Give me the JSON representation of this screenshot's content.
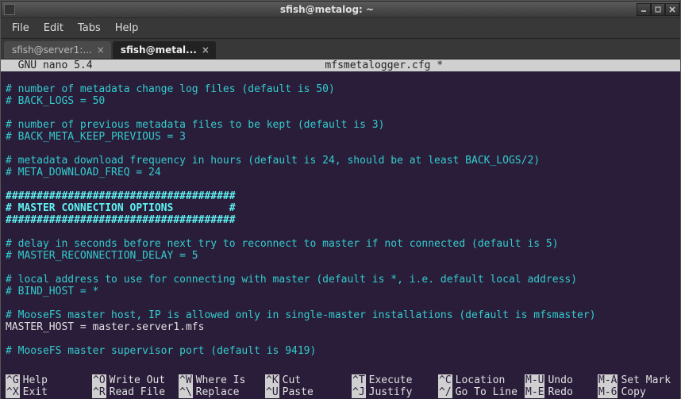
{
  "window": {
    "title": "sfish@metalog: ~"
  },
  "menu": {
    "file": "File",
    "edit": "Edit",
    "tabs": "Tabs",
    "help": "Help"
  },
  "tabs": [
    {
      "label": "sfish@server1:...",
      "active": false
    },
    {
      "label": "sfish@metal...",
      "active": true
    }
  ],
  "nano": {
    "version": "  GNU nano 5.4",
    "filename": "mfsmetalogger.cfg *"
  },
  "content": {
    "l1": "# number of metadata change log files (default is 50)",
    "l2": "# BACK_LOGS = 50",
    "l3": "# number of previous metadata files to be kept (default is 3)",
    "l4": "# BACK_META_KEEP_PREVIOUS = 3",
    "l5": "# metadata download frequency in hours (default is 24, should be at least BACK_LOGS/2)",
    "l6": "# META_DOWNLOAD_FREQ = 24",
    "l7": "#####################################",
    "l8": "# MASTER CONNECTION OPTIONS         #",
    "l9": "#####################################",
    "l10": "# delay in seconds before next try to reconnect to master if not connected (default is 5)",
    "l11": "# MASTER_RECONNECTION_DELAY = 5",
    "l12": "# local address to use for connecting with master (default is *, i.e. default local address)",
    "l13": "# BIND_HOST = *",
    "l14": "# MooseFS master host, IP is allowed only in single-master installations (default is mfsmaster)",
    "l15": "MASTER_HOST = master.server1.mfs",
    "l16": "# MooseFS master supervisor port (default is 9419)"
  },
  "footer": {
    "r1": [
      {
        "k": "^G",
        "l": "Help"
      },
      {
        "k": "^O",
        "l": "Write Out"
      },
      {
        "k": "^W",
        "l": "Where Is"
      },
      {
        "k": "^K",
        "l": "Cut"
      },
      {
        "k": "^T",
        "l": "Execute"
      },
      {
        "k": "^C",
        "l": "Location"
      },
      {
        "k": "M-U",
        "l": "Undo"
      },
      {
        "k": "M-A",
        "l": "Set Mark"
      }
    ],
    "r2": [
      {
        "k": "^X",
        "l": "Exit"
      },
      {
        "k": "^R",
        "l": "Read File"
      },
      {
        "k": "^\\",
        "l": "Replace"
      },
      {
        "k": "^U",
        "l": "Paste"
      },
      {
        "k": "^J",
        "l": "Justify"
      },
      {
        "k": "^/",
        "l": "Go To Line"
      },
      {
        "k": "M-E",
        "l": "Redo"
      },
      {
        "k": "M-6",
        "l": "Copy"
      }
    ]
  }
}
